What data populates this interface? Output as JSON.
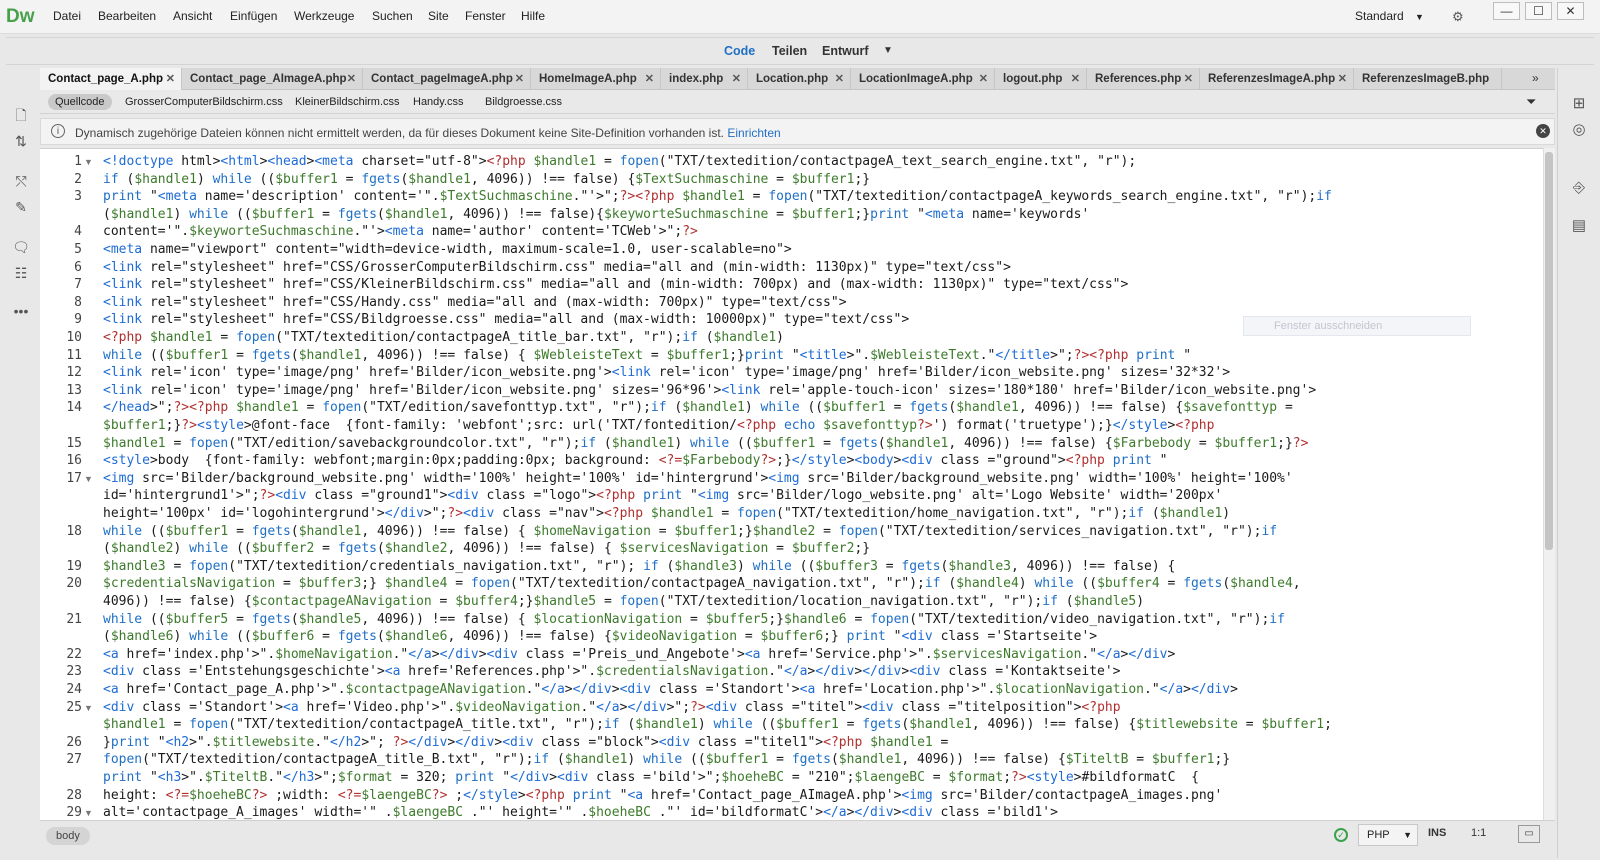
{
  "app": {
    "logo": "Dw"
  },
  "menu": [
    "Datei",
    "Bearbeiten",
    "Ansicht",
    "Einfügen",
    "Werkzeuge",
    "Suchen",
    "Site",
    "Fenster",
    "Hilfe"
  ],
  "workspace": {
    "label": "Standard"
  },
  "window_controls": {
    "minimize": "—",
    "maximize": "☐",
    "close": "✕"
  },
  "views": {
    "code": "Code",
    "split": "Teilen",
    "design": "Entwurf"
  },
  "doc_tabs": [
    "Contact_page_A.php",
    "Contact_page_AImageA.php",
    "Contact_pageImageA.php",
    "HomeImageA.php",
    "index.php",
    "Location.php",
    "LocationImageA.php",
    "logout.php",
    "References.php",
    "ReferenzesImageA.php",
    "ReferenzesImageB.php"
  ],
  "related_files": [
    "Quellcode",
    "GrosserComputerBildschirm.css",
    "KleinerBildschirm.css",
    "Handy.css",
    "Bildgroesse.css"
  ],
  "info": {
    "message": "Dynamisch zugehörige Dateien können nicht ermittelt werden, da für dieses Dokument keine Site-Definition vorhanden ist.",
    "link": "Einrichten"
  },
  "ghost_tooltip": "Fenster ausschneiden",
  "line_numbers": [
    "1",
    "2",
    "3",
    "4",
    "5",
    "6",
    "7",
    "8",
    "9",
    "10",
    "11",
    "12",
    "13",
    "14",
    "15",
    "16",
    "17",
    "18",
    "19",
    "20",
    "21",
    "22",
    "23",
    "24",
    "25",
    "26",
    "27",
    "28",
    "29"
  ],
  "code_lines": [
    "<!doctype html><html><head><meta charset=\"utf-8\"><?php $handle1 = fopen(\"TXT/textedition/contactpageA_text_search_engine.txt\", \"r\");",
    "if ($handle1) while (($buffer1 = fgets($handle1, 4096)) !== false) {$TextSuchmaschine = $buffer1;}",
    "print \"<meta name='description' content='\".$TextSuchmaschine.\"'>\";?><?php $handle1 = fopen(\"TXT/textedition/contactpageA_keywords_search_engine.txt\", \"r\");if",
    "($handle1) while (($buffer1 = fgets($handle1, 4096)) !== false){$keyworteSuchmaschine = $buffer1;}print \"<meta name='keywords'",
    "content='\".$keyworteSuchmaschine.\"'><meta name='author' content='TCWeb'>\";?>",
    "<meta name=\"viewport\" content=\"width=device-width, maximum-scale=1.0, user-scalable=no\">",
    "<link rel=\"stylesheet\" href=\"CSS/GrosserComputerBildschirm.css\" media=\"all and (min-width: 1130px)\" type=\"text/css\">",
    "<link rel=\"stylesheet\" href=\"CSS/KleinerBildschirm.css\" media=\"all and (min-width: 700px) and (max-width: 1130px)\" type=\"text/css\">",
    "<link rel=\"stylesheet\" href=\"CSS/Handy.css\" media=\"all and (max-width: 700px)\" type=\"text/css\">",
    "<link rel=\"stylesheet\" href=\"CSS/Bildgroesse.css\" media=\"all and (max-width: 10000px)\" type=\"text/css\">",
    "<?php $handle1 = fopen(\"TXT/textedition/contactpageA_title_bar.txt\", \"r\");if ($handle1)",
    "while (($buffer1 = fgets($handle1, 4096)) !== false) { $WebleisteText = $buffer1;}print \"<title>\".$WebleisteText.\"</title>\";?><?php print \"",
    "<link rel='icon' type='image/png' href='Bilder/icon_website.png'><link rel='icon' type='image/png' href='Bilder/icon_website.png' sizes='32*32'>",
    "<link rel='icon' type='image/png' href='Bilder/icon_website.png' sizes='96*96'><link rel='apple-touch-icon' sizes='180*180' href='Bilder/icon_website.png'>",
    "</head>\";?><?php $handle1 = fopen(\"TXT/edition/savefonttyp.txt\", \"r\");if ($handle1) while (($buffer1 = fgets($handle1, 4096)) !== false) {$savefonttyp =",
    "$buffer1;}?><style>@font-face  {font-family: 'webfont';src: url('TXT/fontedition/<?php echo $savefonttyp?>') format('truetype');}</style><?php",
    "$handle1 = fopen(\"TXT/edition/savebackgroundcolor.txt\", \"r\");if ($handle1) while (($buffer1 = fgets($handle1, 4096)) !== false) {$Farbebody = $buffer1;}?>",
    "<style>body  {font-family: webfont;margin:0px;padding:0px; background: <?=$Farbebody?>;}</style><body><div class =\"ground\"><?php print \"",
    "<img src='Bilder/background_website.png' width='100%' height='100%' id='hintergrund'><img src='Bilder/background_website.png' width='100%' height='100%'",
    "id='hintergrund1'>\";?><div class =\"ground1\"><div class =\"logo\"><?php print \"<img src='Bilder/logo_website.png' alt='Logo Website' width='200px'",
    "height='100px' id='logohintergrund'></div>\";?><div class =\"nav\"><?php $handle1 = fopen(\"TXT/textedition/home_navigation.txt\", \"r\");if ($handle1)",
    "while (($buffer1 = fgets($handle1, 4096)) !== false) { $homeNavigation = $buffer1;}$handle2 = fopen(\"TXT/textedition/services_navigation.txt\", \"r\");if",
    "($handle2) while (($buffer2 = fgets($handle2, 4096)) !== false) { $servicesNavigation = $buffer2;}",
    "$handle3 = fopen(\"TXT/textedition/credentials_navigation.txt\", \"r\"); if ($handle3) while (($buffer3 = fgets($handle3, 4096)) !== false) {",
    "$credentialsNavigation = $buffer3;} $handle4 = fopen(\"TXT/textedition/contactpageA_navigation.txt\", \"r\");if ($handle4) while (($buffer4 = fgets($handle4,",
    "4096)) !== false) {$contactpageANavigation = $buffer4;}$handle5 = fopen(\"TXT/textedition/location_navigation.txt\", \"r\");if ($handle5)",
    "while (($buffer5 = fgets($handle5, 4096)) !== false) { $locationNavigation = $buffer5;}$handle6 = fopen(\"TXT/textedition/video_navigation.txt\", \"r\");if",
    "($handle6) while (($buffer6 = fgets($handle6, 4096)) !== false) {$videoNavigation = $buffer6;} print \"<div class ='Startseite'>",
    "<a href='index.php'>\".$homeNavigation.\"</a></div><div class ='Preis_und_Angebote'><a href='Service.php'>\".$servicesNavigation.\"</a></div>",
    "<div class ='Entstehungsgeschichte'><a href='References.php'>\".$credentialsNavigation.\"</a></div></div><div class ='Kontaktseite'>",
    "<a href='Contact_page_A.php'>\".$contactpageANavigation.\"</a></div><div class ='Standort'><a href='Location.php'>\".$locationNavigation.\"</a></div>",
    "<div class ='Standort'><a href='Video.php'>\".$videoNavigation.\"</a></div>\";?><div class =\"titel\"><div class =\"titelposition\"><?php",
    "$handle1 = fopen(\"TXT/textedition/contactpageA_title.txt\", \"r\");if ($handle1) while (($buffer1 = fgets($handle1, 4096)) !== false) {$titlewebsite = $buffer1;",
    "}print \"<h2>\".$titlewebsite.\"</h2>\"; ?></div></div><div class =\"block\"><div class =\"titel1\"><?php $handle1 =",
    "fopen(\"TXT/textedition/contactpageA_title_B.txt\", \"r\");if ($handle1) while (($buffer1 = fgets($handle1, 4096)) !== false) {$TiteltB = $buffer1;}",
    "print \"<h3>\".$TiteltB.\"</h3>\";$format = 320; print \"</div><div class ='bild'>\";$hoeheBC = \"210\";$laengeBC = $format;?><style>#bildformatC  {",
    "height: <?=$hoeheBC?> ;width: <?=$laengeBC?> ;</style><?php print \"<a href='Contact_page_AImageA.php'><img src='Bilder/contactpageA_images.png'",
    "alt='contactpage_A_images' width='\" .$laengeBC .\"' height='\" .$hoeheBC .\"' id='bildformatC'></a></div><div class ='bild1'>"
  ],
  "status": {
    "tag": "body",
    "language": "PHP",
    "insert_mode": "INS",
    "cursor": "1:1"
  },
  "colors": {
    "accent": "#1f6fc5",
    "logo": "#47a14a",
    "tag": "#1e6bd6",
    "php": "#b03030",
    "variable": "#3d7a2c",
    "string": "#6b1f8e"
  }
}
